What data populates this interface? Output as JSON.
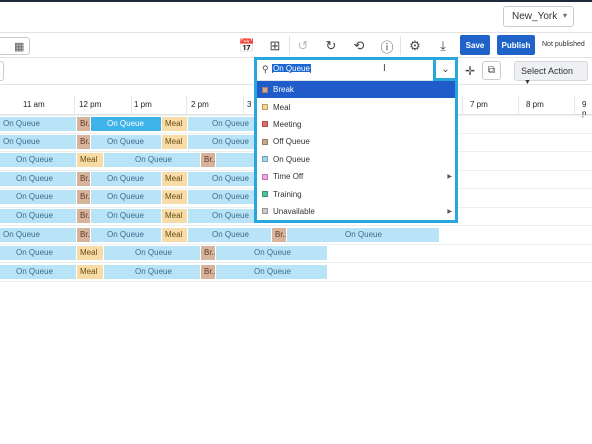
{
  "timezone": {
    "value": "New_York"
  },
  "toolbar": {
    "icons": [
      "calendar-icon",
      "calendar-week-icon",
      "calendar-add-icon",
      "undo-icon",
      "redo-icon",
      "history-icon",
      "info-icon",
      "settings-icon",
      "download-icon"
    ],
    "save_label": "Save",
    "publish_label": "Publish",
    "publish_status": "Not published"
  },
  "action_row": {
    "select_action_label": "Select Action"
  },
  "timeline": {
    "hours": [
      "11 am",
      "12 pm",
      "1 pm",
      "2 pm",
      "3",
      "7 pm",
      "8 pm",
      "9 p"
    ]
  },
  "dropdown": {
    "search_value": "On Queue",
    "items": [
      {
        "label": "Break",
        "color": "#d8a48f",
        "selected": true,
        "submenu": false
      },
      {
        "label": "Meal",
        "color": "#f6d58e",
        "selected": false,
        "submenu": false
      },
      {
        "label": "Meeting",
        "color": "#e46a6a",
        "selected": false,
        "submenu": false
      },
      {
        "label": "Off Queue",
        "color": "#c9a98c",
        "selected": false,
        "submenu": false
      },
      {
        "label": "On Queue",
        "color": "#9fd6f1",
        "selected": false,
        "submenu": false
      },
      {
        "label": "Time Off",
        "color": "#f2a6e6",
        "selected": false,
        "submenu": true
      },
      {
        "label": "Training",
        "color": "#4dc59a",
        "selected": false,
        "submenu": false
      },
      {
        "label": "Unavailable",
        "color": "#c8c8c8",
        "selected": false,
        "submenu": true
      }
    ]
  },
  "schedule": {
    "rows": [
      [
        {
          "label": "On Queue",
          "type": "queue"
        },
        {
          "label": "Br...",
          "type": "break"
        },
        {
          "label": "On Queue",
          "type": "queue-sel"
        },
        {
          "label": "Meal",
          "type": "meal"
        },
        {
          "label": "On Queue",
          "type": "queue"
        }
      ],
      [
        {
          "label": "On Queue",
          "type": "queue"
        },
        {
          "label": "Br...",
          "type": "break"
        },
        {
          "label": "On Queue",
          "type": "queue"
        },
        {
          "label": "Meal",
          "type": "meal"
        },
        {
          "label": "On Queue",
          "type": "queue"
        }
      ],
      [
        {
          "label": "On Queue",
          "type": "queue"
        },
        {
          "label": "Meal",
          "type": "meal"
        },
        {
          "label": "On Queue",
          "type": "queue"
        },
        {
          "label": "Br...",
          "type": "break"
        },
        {
          "label": "",
          "type": "queue"
        }
      ],
      [
        {
          "label": "On Queue",
          "type": "queue"
        },
        {
          "label": "Br...",
          "type": "break"
        },
        {
          "label": "On Queue",
          "type": "queue"
        },
        {
          "label": "Meal",
          "type": "meal"
        },
        {
          "label": "On Queue",
          "type": "queue"
        }
      ],
      [
        {
          "label": "On Queue",
          "type": "queue"
        },
        {
          "label": "Br...",
          "type": "break"
        },
        {
          "label": "On Queue",
          "type": "queue"
        },
        {
          "label": "Meal",
          "type": "meal"
        },
        {
          "label": "On Queue",
          "type": "queue"
        }
      ],
      [
        {
          "label": "On Queue",
          "type": "queue"
        },
        {
          "label": "Br...",
          "type": "break"
        },
        {
          "label": "On Queue",
          "type": "queue"
        },
        {
          "label": "Meal",
          "type": "meal"
        },
        {
          "label": "On Queue",
          "type": "queue"
        }
      ],
      [
        {
          "label": "On Queue",
          "type": "queue"
        },
        {
          "label": "Br...",
          "type": "break"
        },
        {
          "label": "On Queue",
          "type": "queue"
        },
        {
          "label": "Meal",
          "type": "meal"
        },
        {
          "label": "On Queue",
          "type": "queue"
        },
        {
          "label": "Br...",
          "type": "break"
        },
        {
          "label": "On Queue",
          "type": "queue"
        }
      ],
      [
        {
          "label": "On Queue",
          "type": "queue"
        },
        {
          "label": "Meal",
          "type": "meal"
        },
        {
          "label": "On Queue",
          "type": "queue"
        },
        {
          "label": "Br...",
          "type": "break"
        },
        {
          "label": "On Queue",
          "type": "queue"
        }
      ],
      [
        {
          "label": "On Queue",
          "type": "queue"
        },
        {
          "label": "Meal",
          "type": "meal"
        },
        {
          "label": "On Queue",
          "type": "queue"
        },
        {
          "label": "Br...",
          "type": "break"
        },
        {
          "label": "On Queue",
          "type": "queue"
        }
      ]
    ]
  }
}
